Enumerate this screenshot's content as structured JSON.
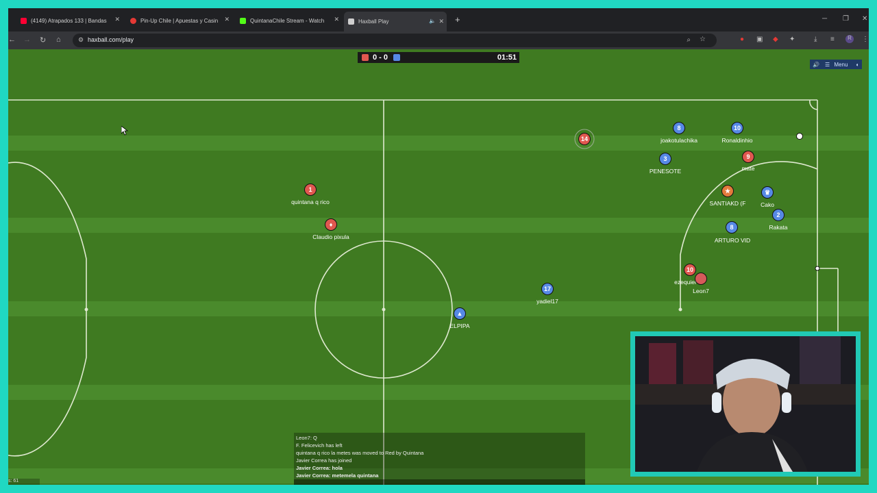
{
  "tabs": [
    {
      "title": "(4149) Atrapados 133 | Bandas",
      "favicon_color": "#ff0033"
    },
    {
      "title": "Pin-Up Chile | Apuestas y Casin",
      "favicon_color": "#e53935"
    },
    {
      "title": "QuintanaChile Stream - Watch",
      "favicon_color": "#53fc18"
    },
    {
      "title": "Haxball Play",
      "favicon_color": "#cfcfcf"
    }
  ],
  "address_bar": {
    "url": "haxball.com/play"
  },
  "scoreboard": {
    "red_score": "0",
    "separator": "-",
    "blue_score": "0",
    "score_text": "0 - 0",
    "timer": "01:51",
    "red_color": "#e0584f",
    "blue_color": "#5689e5"
  },
  "menu_button": {
    "label": "Menu"
  },
  "players": [
    {
      "avatar": "1",
      "name": "quintana q rico",
      "team": "red"
    },
    {
      "avatar": "♦",
      "name": "Claudio pixula",
      "team": "red"
    },
    {
      "avatar": "14",
      "name": "",
      "team": "red"
    },
    {
      "avatar": "8",
      "name": "joakotulachika",
      "team": "blue"
    },
    {
      "avatar": "10",
      "name": "Ronaldinhio",
      "team": "blue"
    },
    {
      "avatar": "9",
      "name": "mate",
      "team": "red"
    },
    {
      "avatar": "3",
      "name": "PENESOTE",
      "team": "blue"
    },
    {
      "avatar": "★",
      "name": "SANTIAKD (F",
      "team": "red"
    },
    {
      "avatar": "♛",
      "name": "Cako",
      "team": "blue"
    },
    {
      "avatar": "2",
      "name": "Rakata",
      "team": "blue"
    },
    {
      "avatar": "8",
      "name": "ARTURO VID",
      "team": "blue"
    },
    {
      "avatar": "10",
      "name": "ezequiel",
      "team": "red"
    },
    {
      "avatar": "",
      "name": "Leon7",
      "team": "red"
    },
    {
      "avatar": "17",
      "name": "yadiel17",
      "team": "blue"
    },
    {
      "avatar": "▲",
      "name": "ELPIPA",
      "team": "blue"
    }
  ],
  "chat": [
    {
      "text": "Leon7: Q",
      "bold": false
    },
    {
      "text": "F. Felicevich has left",
      "bold": false
    },
    {
      "text": "quintana q rico la metes was moved to Red by Quintana",
      "bold": false
    },
    {
      "text": "Javier Correa has joined",
      "bold": false
    },
    {
      "text": "Javier Correa: hola",
      "bold": true
    },
    {
      "text": "Javier Correa: metemela quintana",
      "bold": true
    }
  ],
  "fps_text": "s: 61",
  "icons": [
    "back-icon",
    "forward-icon",
    "reload-icon",
    "home-icon",
    "zoom-icon",
    "star-icon",
    "extensions-icon",
    "download-icon",
    "profile-icon",
    "sound-icon",
    "menu-icon"
  ]
}
